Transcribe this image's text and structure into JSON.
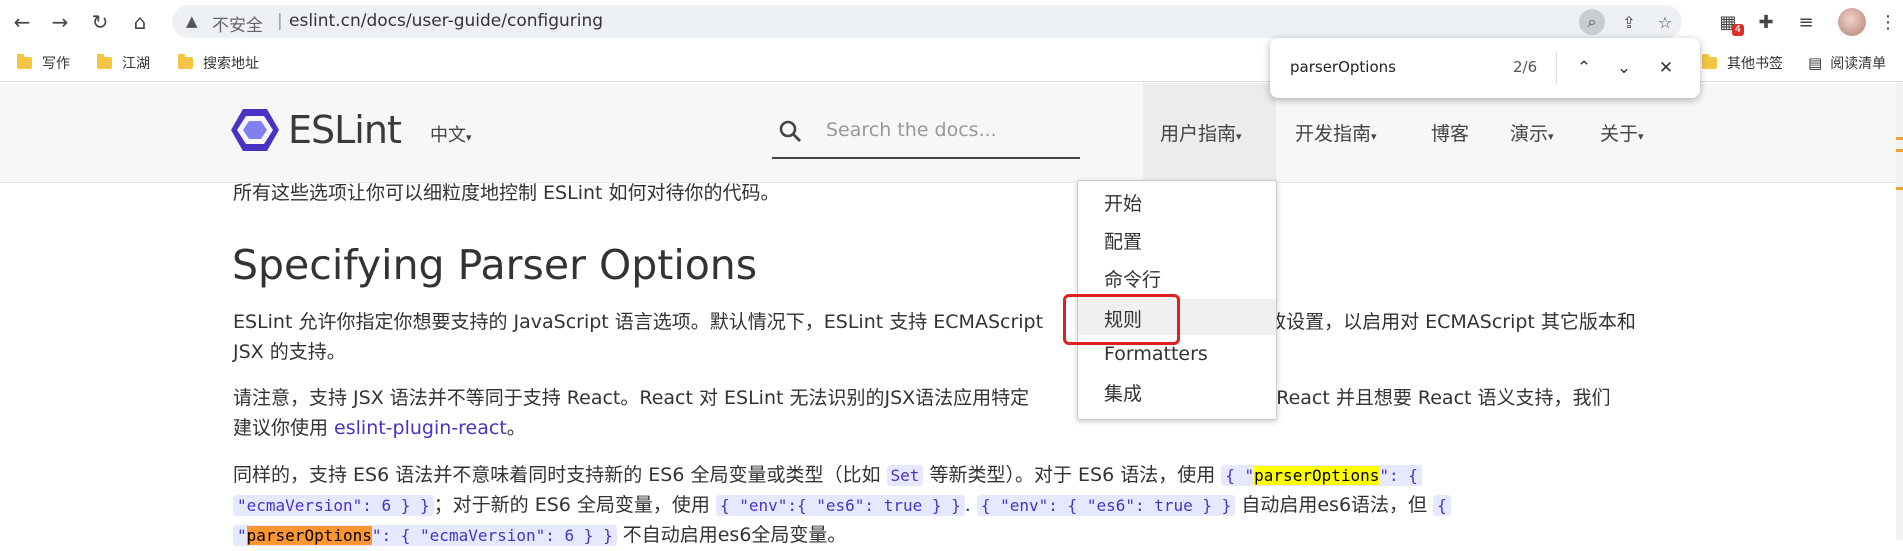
{
  "browser": {
    "security_label": "不安全",
    "separator": "|",
    "url": "eslint.cn/docs/user-guide/configuring",
    "extension_badge": "4"
  },
  "bookmarks": {
    "items": [
      {
        "label": "写作"
      },
      {
        "label": "江湖"
      },
      {
        "label": "搜索地址"
      }
    ],
    "other_bookmarks": "其他书签",
    "reading_list": "阅读清单"
  },
  "find_bar": {
    "query": "parserOptions",
    "count": "2/6"
  },
  "site": {
    "logo_text": "ESLint",
    "language": "中文",
    "search_placeholder": "Search the docs...",
    "nav": [
      {
        "label": "用户指南"
      },
      {
        "label": "开发指南"
      },
      {
        "label": "博客"
      },
      {
        "label": "演示"
      },
      {
        "label": "关于"
      }
    ],
    "dropdown": [
      {
        "label": "开始"
      },
      {
        "label": "配置"
      },
      {
        "label": "命令行"
      },
      {
        "label": "规则"
      },
      {
        "label": "Formatters"
      },
      {
        "label": "集成"
      }
    ]
  },
  "content": {
    "intro": "所有这些选项让你可以细粒度地控制 ESLint 如何对待你的代码。",
    "heading": "Specifying Parser Options",
    "para1_a": "ESLint 允许你指定你想要支持的 JavaScript 语言选项。默认情况下，ESLint 支持 ECMAScript",
    "para1_b": "改设置，以启用对 ECMAScript 其它版本和",
    "para1_line2": "JSX 的支持。",
    "para2_a": "请注意，支持 JSX 语法并不等同于支持 React。React 对 ESLint 无法识别的JSX语法应用特定",
    "para2_b": "使用 React 并且想要 React 语义支持，我们",
    "para2_line2_a": "建议你使用 ",
    "para2_link": "eslint-plugin-react",
    "para2_line2_b": "。",
    "para3_a": "同样的，支持 ES6 语法并不意味着同时支持新的 ES6 全局变量或类型（比如 ",
    "para3_code1": "Set",
    "para3_b": " 等新类型）。对于 ES6 语法，使用 ",
    "para3_code2_a": "{ \"",
    "para3_code2_hl": "parserOptions",
    "para3_code2_b": "\": {",
    "para3_code2_c": "\"ecmaVersion\": 6 } }",
    "para3_c": "；对于新的 ES6 全局变量，使用 ",
    "para3_code3": "{ \"env\":{ \"es6\": true } }",
    "para3_d": ". ",
    "para3_code4": "{ \"env\": { \"es6\": true } }",
    "para3_e": " 自动启用es6语法，但 ",
    "para3_code5": "{",
    "para3_code6_a": "\"",
    "para3_code6_hl": "parserOptions",
    "para3_code6_b": "\": { \"ecmaVersion\": 6 } }",
    "para3_f": " 不自动启用es6全局变量。"
  }
}
